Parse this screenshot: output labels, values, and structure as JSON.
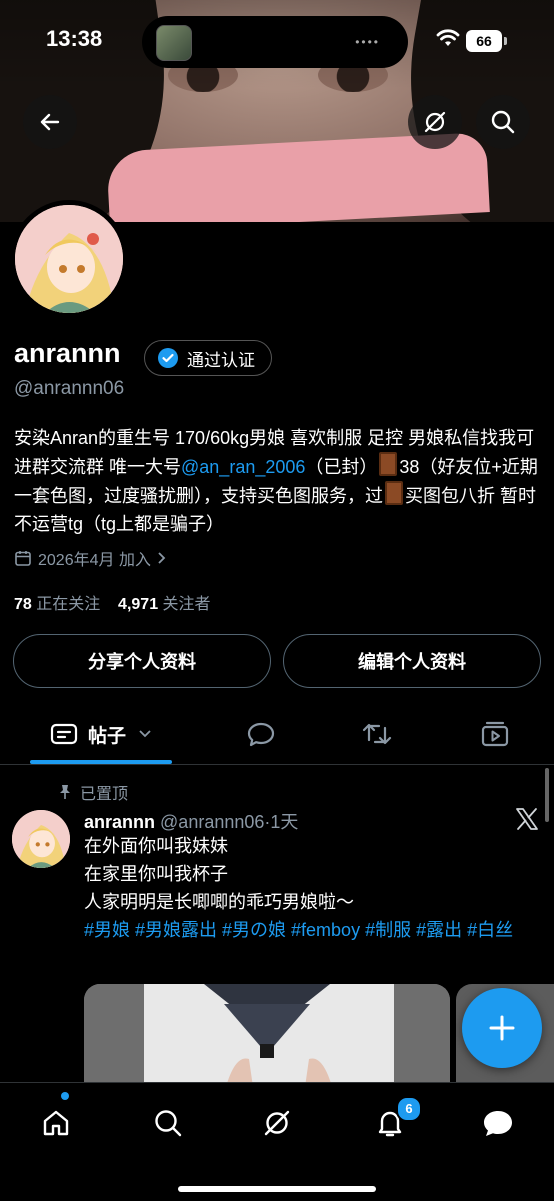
{
  "status_bar": {
    "time": "13:38",
    "battery": "66"
  },
  "profile": {
    "display_name": "anrannn",
    "verified_label": "通过认证",
    "handle": "@anrannn06",
    "bio_part1": "安染Anran的重生号 170/60kg男娘 喜欢制服 足控 男娘私信找我可进群交流群 唯一大号",
    "bio_link": "@an_ran_2006",
    "bio_part2": "（已封）",
    "bio_part3": "38（好友位+近期一套色图，过度骚扰删），支持买色图服务，过",
    "bio_part4": "买图包八折 暂时不运营tg（tg上都是骗子）",
    "joined": "2026年4月 加入",
    "following_count": "78",
    "following_label": "正在关注",
    "followers_count": "4,971",
    "followers_label": "关注者",
    "share_button": "分享个人资料",
    "edit_button": "编辑个人资料"
  },
  "tabs": {
    "posts_label": "帖子"
  },
  "pinned_post": {
    "pinned_label": "已置顶",
    "author": "anrannn",
    "handle": "@anrannn06",
    "sep": "·",
    "time": "1天",
    "line1": "在外面你叫我妹妹",
    "line2": "在家里你叫我杯子",
    "line3": "人家明明是长唧唧的乖巧男娘啦～",
    "hashtags": "#男娘 #男娘露出 #男の娘 #femboy #制服 #露出 #白丝"
  },
  "bottom_nav": {
    "notifications_badge": "6"
  },
  "colors": {
    "accent": "#1d9bf0",
    "background": "#000000",
    "secondary_text": "#8b98a5"
  }
}
